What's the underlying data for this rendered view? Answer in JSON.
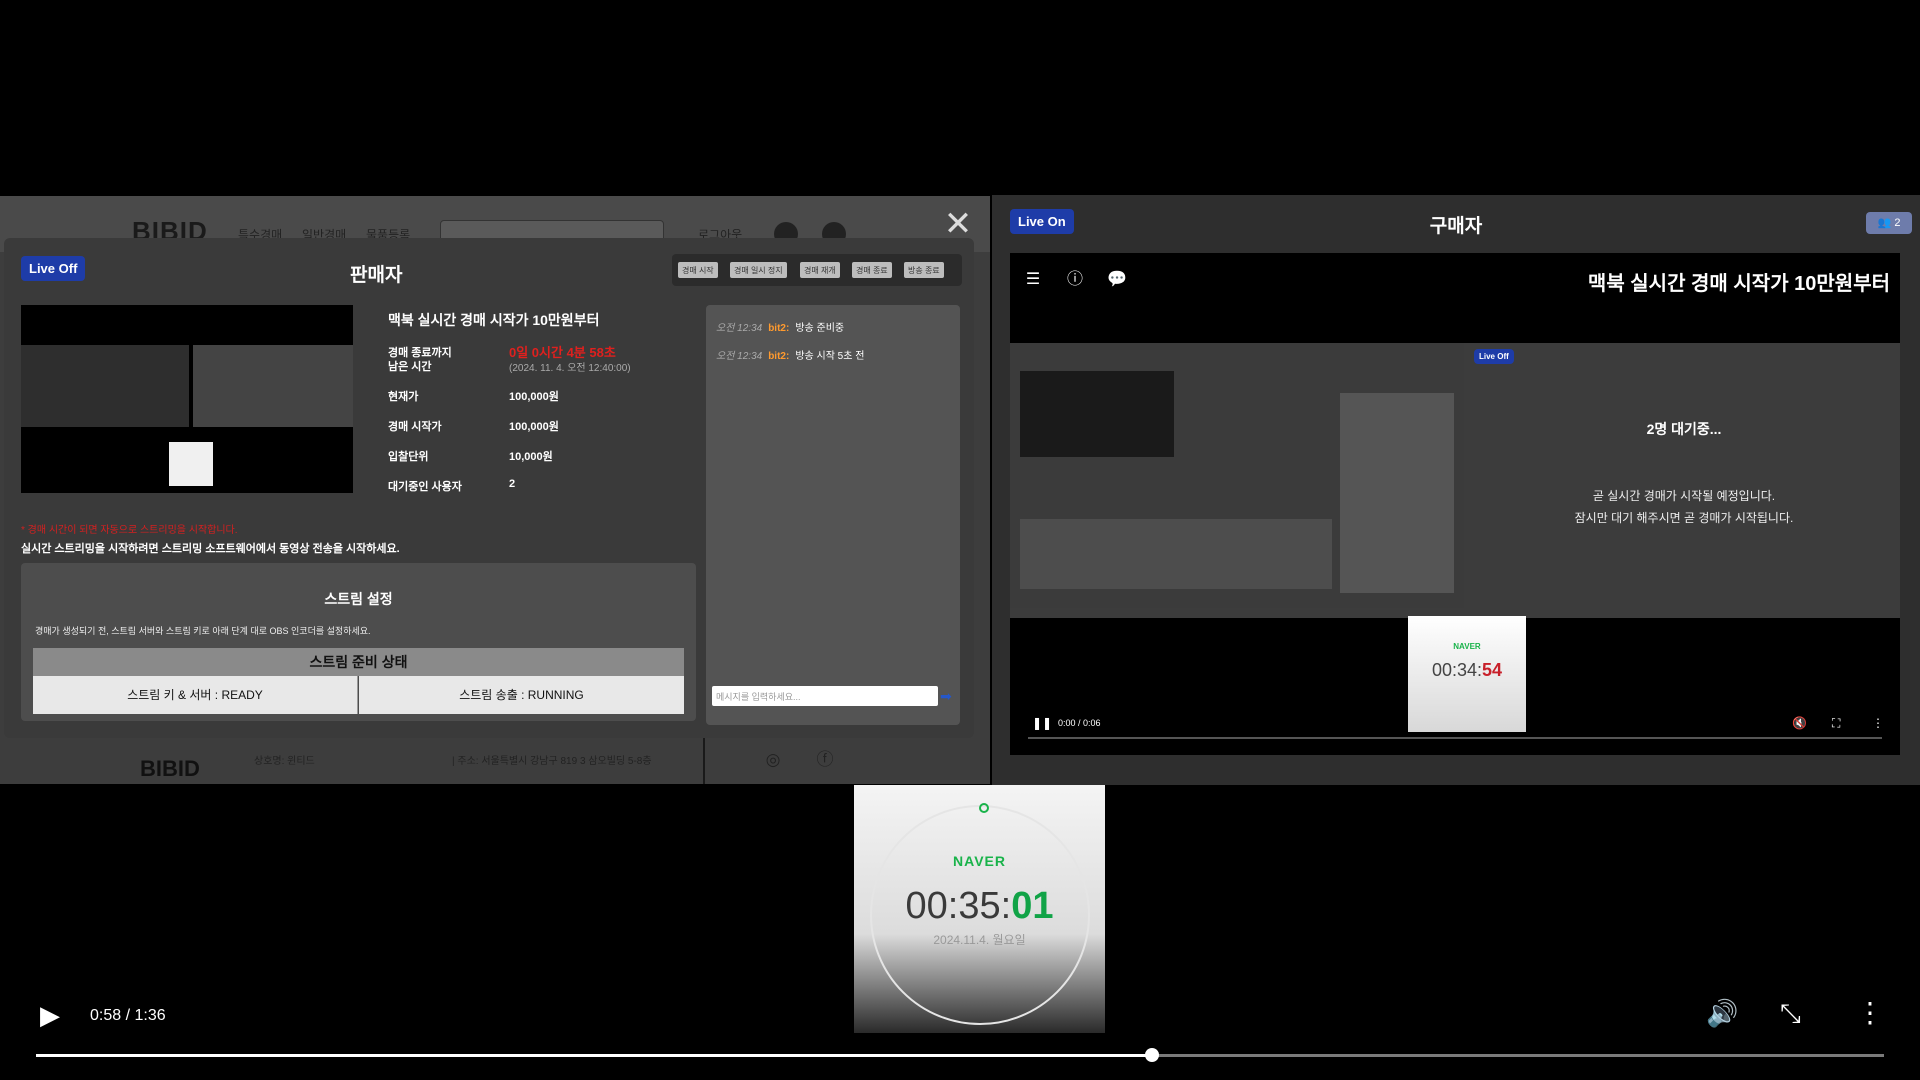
{
  "seller_site": {
    "logo": "BIBID",
    "nav": [
      "특수경매",
      "일반경매",
      "물품등록"
    ],
    "login": "로그아웃"
  },
  "seller": {
    "status_badge": "Live Off",
    "title": "판매자",
    "controls": [
      "경매 시작",
      "경매 일시 정지",
      "경매 재개",
      "경매 종료",
      "방송 종료"
    ],
    "auction_title": "맥북 실시간 경매 시작가 10만원부터",
    "rows": [
      {
        "label": "경매 종료까지",
        "value": "0일 0시간 4분 58초"
      },
      {
        "label": "남은 시간",
        "value": "(2024. 11. 4. 오전 12:40:00)"
      },
      {
        "label": "현재가",
        "value": "100,000원"
      },
      {
        "label": "경매 시작가",
        "value": "100,000원"
      },
      {
        "label": "입찰단위",
        "value": "10,000원"
      },
      {
        "label": "대기중인 사용자",
        "value": "2"
      }
    ],
    "warning_red": "* 경매 시간이 되면 자동으로 스트리밍을 시작합니다.",
    "warning_white": "실시간 스트리밍을 시작하려면 스트리밍 소프트웨어에서 동영상 전송을 시작하세요.",
    "stream": {
      "title": "스트림 설정",
      "desc": "경매가 생성되기 전, 스트림 서버와 스트림 키로 아래 단계 대로 OBS 인코더를 설정하세요.",
      "status_head": "스트림 준비 상태",
      "cell_key": "스트림 키 & 서버 : READY",
      "cell_send": "스트림 송출 : RUNNING"
    },
    "chat": [
      {
        "time": "오전 12:34",
        "user": "bit2:",
        "msg": "방송 준비중"
      },
      {
        "time": "오전 12:34",
        "user": "bit2:",
        "msg": "방송 시작 5초 전"
      }
    ],
    "chat_placeholder": "메시지를 입력하세요...",
    "footer": {
      "logo": "BIBID",
      "company": "상호명: 윈티드",
      "address": "| 주소: 서울특별시 강남구 819 3 삼오빌딩 5-8층"
    }
  },
  "buyer": {
    "status_badge": "Live On",
    "title": "구매자",
    "viewer_count": "2",
    "video_title": "맥북 실시간 경매 시작가 10만원부터",
    "nested_badge": "Live Off",
    "waiting": "2명 대기중...",
    "msg1": "곧 실시간 경매가 시작될 예정입니다.",
    "msg2": "잠시만 대기 해주시면 곧 경매가 시작됩니다.",
    "mini_time_main": "00:34:",
    "mini_time_sec": "54",
    "mini_time_label": "NAVER",
    "video_time": "0:00 / 0:06"
  },
  "stopwatch": {
    "brand": "NAVER",
    "time_main": "00:35:",
    "time_sec": "01",
    "date": "2024.11.4. 월요일"
  },
  "player": {
    "time": "0:58 / 1:36",
    "progress": 0.604
  }
}
